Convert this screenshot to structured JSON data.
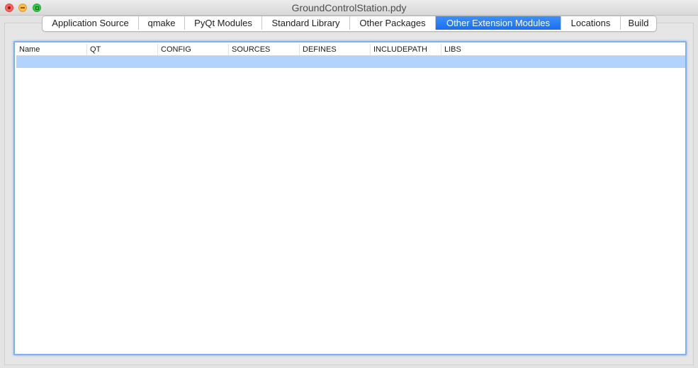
{
  "window": {
    "title": "GroundControlStation.pdy"
  },
  "tabs": [
    {
      "label": "Application Source",
      "active": false
    },
    {
      "label": "qmake",
      "active": false
    },
    {
      "label": "PyQt Modules",
      "active": false
    },
    {
      "label": "Standard Library",
      "active": false
    },
    {
      "label": "Other Packages",
      "active": false
    },
    {
      "label": "Other Extension Modules",
      "active": true
    },
    {
      "label": "Locations",
      "active": false
    },
    {
      "label": "Build",
      "active": false
    }
  ],
  "table": {
    "columns": [
      "Name",
      "QT",
      "CONFIG",
      "SOURCES",
      "DEFINES",
      "INCLUDEPATH",
      "LIBS"
    ],
    "rows": [
      {
        "selected": true,
        "cells": [
          "",
          "",
          "",
          "",
          "",
          "",
          ""
        ]
      }
    ]
  },
  "colors": {
    "accent": "#1a6ef5",
    "selection": "#b1d3fc",
    "focus_ring": "#7fb1f2"
  },
  "icons": {
    "close": "close-icon",
    "minimize": "minimize-icon",
    "zoom": "zoom-icon"
  }
}
